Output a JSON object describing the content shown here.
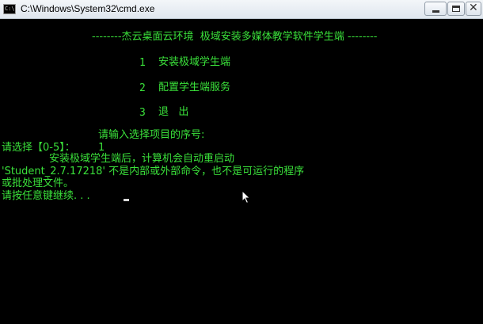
{
  "window": {
    "title": "C:\\Windows\\System32\\cmd.exe",
    "icon_label": "C:\\"
  },
  "console": {
    "header": "--------杰云桌面云环境  极域安装多媒体教学软件学生端 --------",
    "menu": [
      {
        "num": "1",
        "label": "安装极域学生端"
      },
      {
        "num": "2",
        "label": "配置学生端服务"
      },
      {
        "num": "3",
        "label": "退   出"
      }
    ],
    "prompt": "请输入选择项目的序号:",
    "choice_prompt": "请选择【0-5】：",
    "choice_value": "1",
    "install_msg": "安装极域学生端后，计算机会自动重启动",
    "error_line1": "'Student_2.7.17218' 不是内部或外部命令，也不是可运行的程序",
    "error_line2": "或批处理文件。",
    "pause_msg": "请按任意键继续. . ."
  },
  "colors": {
    "console_bg": "#000000",
    "console_text": "#3ae03a",
    "titlebar": "#e9eef3"
  }
}
